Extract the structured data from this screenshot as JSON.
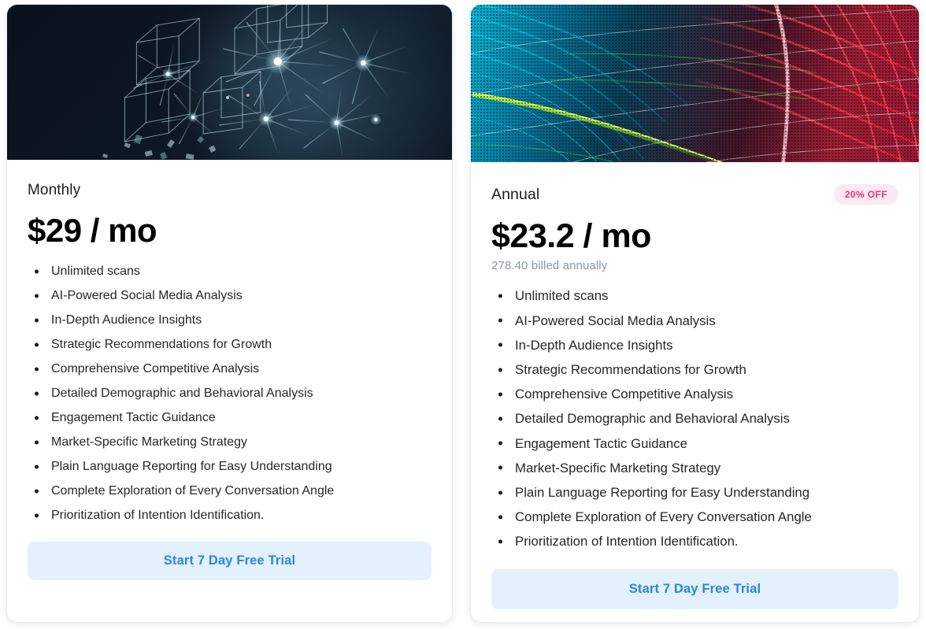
{
  "theme": {
    "page_background": "#ffffff",
    "card_background": "#ffffff",
    "card_border": "#eceef1",
    "text_primary": "#1b1b1f",
    "text_body": "#26272b",
    "text_muted": "#8a95a3",
    "badge_background": "#fde9f1",
    "badge_text": "#ef2f7a",
    "cta_background": "#e3f1fc",
    "cta_text": "#2a86e0"
  },
  "plans": [
    {
      "id": "monthly",
      "hero_image": "abstract-wireframe-cubes-stage-lights",
      "name": "Monthly",
      "badge": null,
      "price": "$29 / mo",
      "billed_note": null,
      "features": [
        "Unlimited scans",
        "AI-Powered Social Media Analysis",
        "In-Depth Audience Insights",
        "Strategic Recommendations for Growth",
        "Comprehensive Competitive Analysis",
        "Detailed Demographic and Behavioral Analysis",
        "Engagement Tactic Guidance",
        "Market-Specific Marketing Strategy",
        "Plain Language Reporting for Easy Understanding",
        "Complete Exploration of Every Conversation Angle",
        "Prioritization of Intention Identification."
      ],
      "cta_label": "Start 7 Day Free Trial"
    },
    {
      "id": "annual",
      "hero_image": "abstract-colorful-particle-wave-mesh",
      "name": "Annual",
      "badge": "20% OFF",
      "price": "$23.2 / mo",
      "billed_note": "278.40 billed annually",
      "features": [
        "Unlimited scans",
        "AI-Powered Social Media Analysis",
        "In-Depth Audience Insights",
        "Strategic Recommendations for Growth",
        "Comprehensive Competitive Analysis",
        "Detailed Demographic and Behavioral Analysis",
        "Engagement Tactic Guidance",
        "Market-Specific Marketing Strategy",
        "Plain Language Reporting for Easy Understanding",
        "Complete Exploration of Every Conversation Angle",
        "Prioritization of Intention Identification."
      ],
      "cta_label": "Start 7 Day Free Trial"
    }
  ]
}
